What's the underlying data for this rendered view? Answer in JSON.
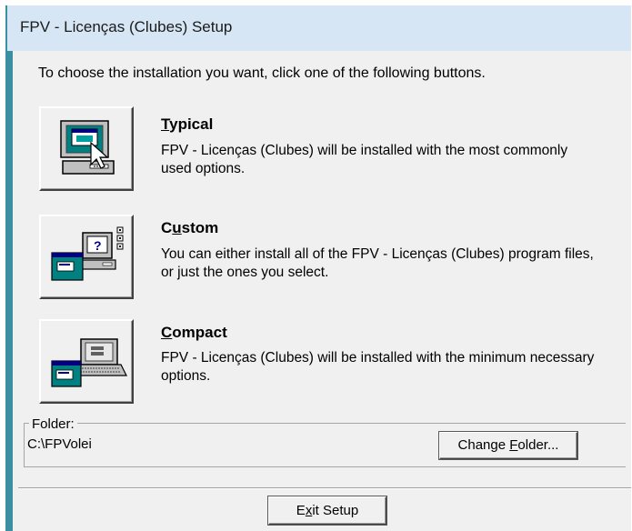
{
  "window": {
    "title": "FPV - Licenças (Clubes) Setup"
  },
  "instructions": "To choose the installation you want, click one of the following buttons.",
  "options": [
    {
      "title_mnemonic": "T",
      "title_rest": "ypical",
      "description": "FPV - Licenças (Clubes) will be installed with the most commonly used options.",
      "icon": "computer-pointer-icon"
    },
    {
      "title_prefix": "C",
      "title_mnemonic": "u",
      "title_rest": "stom",
      "description": "You can either install all of the FPV - Licenças (Clubes) program files, or just the ones you select.",
      "icon": "computer-question-icon"
    },
    {
      "title_mnemonic": "C",
      "title_rest": "ompact",
      "description": "FPV - Licenças (Clubes) will be installed with the minimum necessary options.",
      "icon": "laptop-computer-icon"
    }
  ],
  "folder": {
    "label": "Folder:",
    "path": "C:\\FPVolei",
    "change_prefix": "Change ",
    "change_mnemonic": "F",
    "change_rest": "older..."
  },
  "exit": {
    "prefix": "E",
    "mnemonic": "x",
    "rest": "it Setup"
  },
  "colors": {
    "titlebar": "#d6e6f4",
    "dialog": "#f0f0f0",
    "frame": "#3a8fa0"
  }
}
